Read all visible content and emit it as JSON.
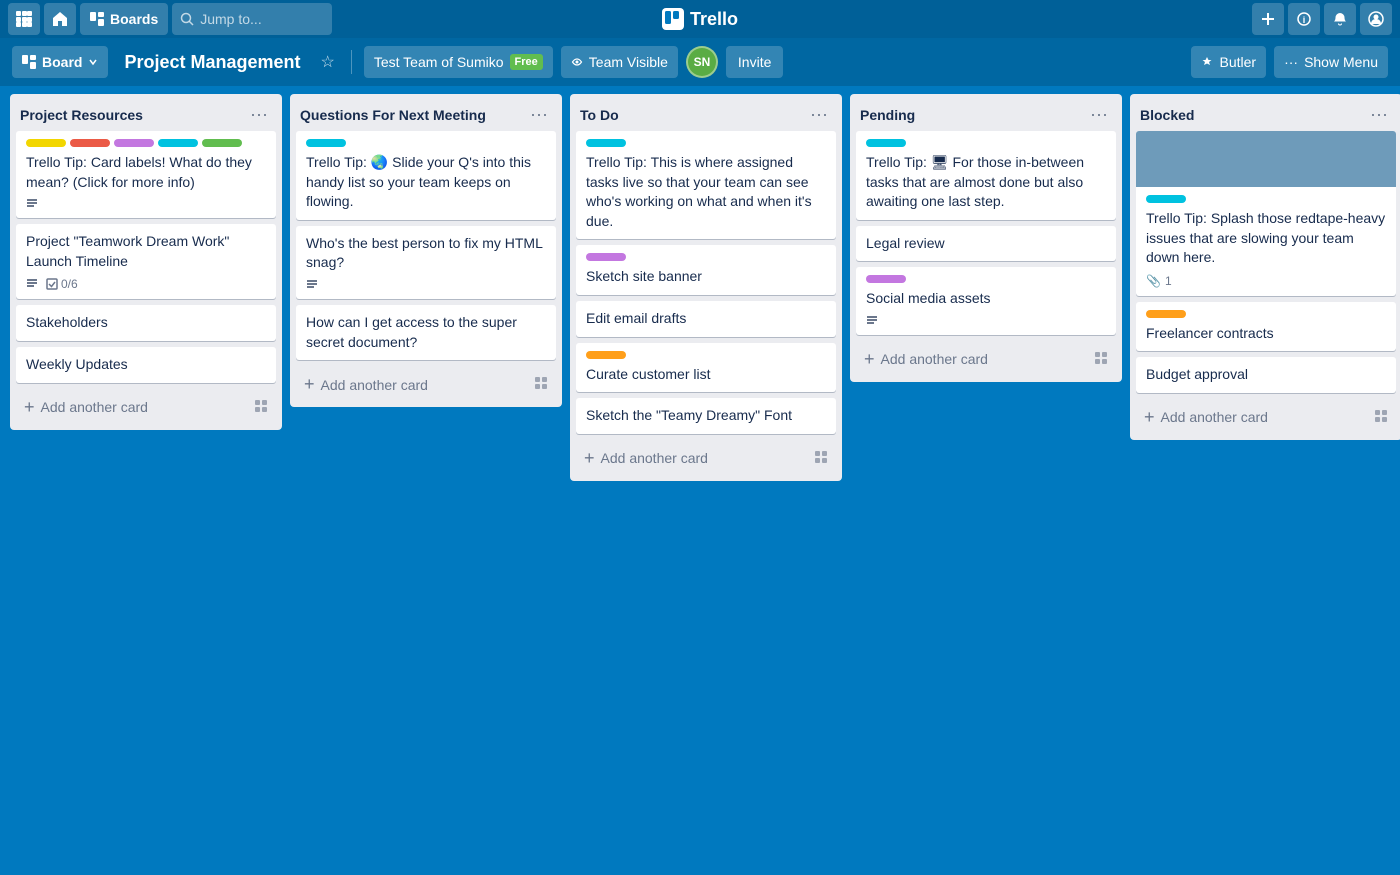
{
  "topNav": {
    "appsBtnLabel": "⊞",
    "homeBtnLabel": "⌂",
    "boardsBtnLabel": "Boards",
    "searchPlaceholder": "Jump to...",
    "logoText": "Trello",
    "addBtnLabel": "+",
    "infoBtnLabel": "ℹ",
    "notifyBtnLabel": "🔔",
    "profileBtnLabel": "👤"
  },
  "boardHeader": {
    "boardBtnLabel": "Board",
    "title": "Project Management",
    "teamBtnLabel": "Test Team of Sumiko",
    "teamBadge": "Free",
    "visibilityLabel": "Team Visible",
    "avatarText": "SN",
    "inviteLabel": "Invite",
    "butlerLabel": "Butler",
    "showMenuLabel": "Show Menu"
  },
  "lists": [
    {
      "id": "project-resources",
      "title": "Project Resources",
      "cards": [
        {
          "id": "pr-1",
          "labels": [
            {
              "color": "label-yellow"
            },
            {
              "color": "label-red"
            },
            {
              "color": "label-purple"
            },
            {
              "color": "label-teal"
            },
            {
              "color": "label-green"
            }
          ],
          "text": "Trello Tip: Card labels! What do they mean? (Click for more info)",
          "meta": {
            "description": true
          }
        },
        {
          "id": "pr-2",
          "labels": [],
          "text": "Project \"Teamwork Dream Work\" Launch Timeline",
          "meta": {
            "description": true,
            "checklist": "0/6"
          }
        },
        {
          "id": "pr-3",
          "labels": [],
          "text": "Stakeholders",
          "meta": {}
        },
        {
          "id": "pr-4",
          "labels": [],
          "text": "Weekly Updates",
          "meta": {}
        }
      ],
      "addCardLabel": "Add another card"
    },
    {
      "id": "questions-next-meeting",
      "title": "Questions For Next Meeting",
      "cards": [
        {
          "id": "qnm-1",
          "labels": [
            {
              "color": "label-teal"
            }
          ],
          "text": "Trello Tip: 🌏 Slide your Q's into this handy list so your team keeps on flowing.",
          "meta": {}
        },
        {
          "id": "qnm-2",
          "labels": [],
          "text": "Who's the best person to fix my HTML snag?",
          "meta": {
            "description": true
          }
        },
        {
          "id": "qnm-3",
          "labels": [],
          "text": "How can I get access to the super secret document?",
          "meta": {}
        }
      ],
      "addCardLabel": "Add another card"
    },
    {
      "id": "to-do",
      "title": "To Do",
      "cards": [
        {
          "id": "td-1",
          "labels": [
            {
              "color": "label-teal"
            }
          ],
          "text": "Trello Tip: This is where assigned tasks live so that your team can see who's working on what and when it's due.",
          "meta": {}
        },
        {
          "id": "td-2",
          "labels": [
            {
              "color": "label-purple"
            }
          ],
          "text": "Sketch site banner",
          "meta": {}
        },
        {
          "id": "td-3",
          "labels": [],
          "text": "Edit email drafts",
          "meta": {}
        },
        {
          "id": "td-4",
          "labels": [
            {
              "color": "label-orange"
            }
          ],
          "text": "Curate customer list",
          "meta": {}
        },
        {
          "id": "td-5",
          "labels": [],
          "text": "Sketch the \"Teamy Dreamy\" Font",
          "meta": {}
        }
      ],
      "addCardLabel": "Add another card"
    },
    {
      "id": "pending",
      "title": "Pending",
      "cards": [
        {
          "id": "pe-1",
          "labels": [
            {
              "color": "label-teal"
            }
          ],
          "text": "Trello Tip: 🖥 For those in-between tasks that are almost done but also awaiting one last step.",
          "meta": {}
        },
        {
          "id": "pe-2",
          "labels": [],
          "text": "Legal review",
          "meta": {}
        },
        {
          "id": "pe-3",
          "labels": [
            {
              "color": "label-purple"
            }
          ],
          "text": "Social media assets",
          "meta": {
            "description": true
          }
        }
      ],
      "addCardLabel": "Add another card"
    },
    {
      "id": "blocked",
      "title": "Blocked",
      "cards": [
        {
          "id": "bl-0",
          "isImageCard": true,
          "imageBg": "#6e9bba",
          "labels": [
            {
              "color": "label-teal"
            }
          ],
          "text": "Trello Tip: Splash those redtape-heavy issues that are slowing your team down here.",
          "attachment": "1",
          "meta": {}
        },
        {
          "id": "bl-1",
          "labels": [
            {
              "color": "label-orange"
            }
          ],
          "text": "Freelancer contracts",
          "meta": {}
        },
        {
          "id": "bl-2",
          "labels": [],
          "text": "Budget approval",
          "meta": {}
        }
      ],
      "addCardLabel": "Add another card"
    }
  ]
}
